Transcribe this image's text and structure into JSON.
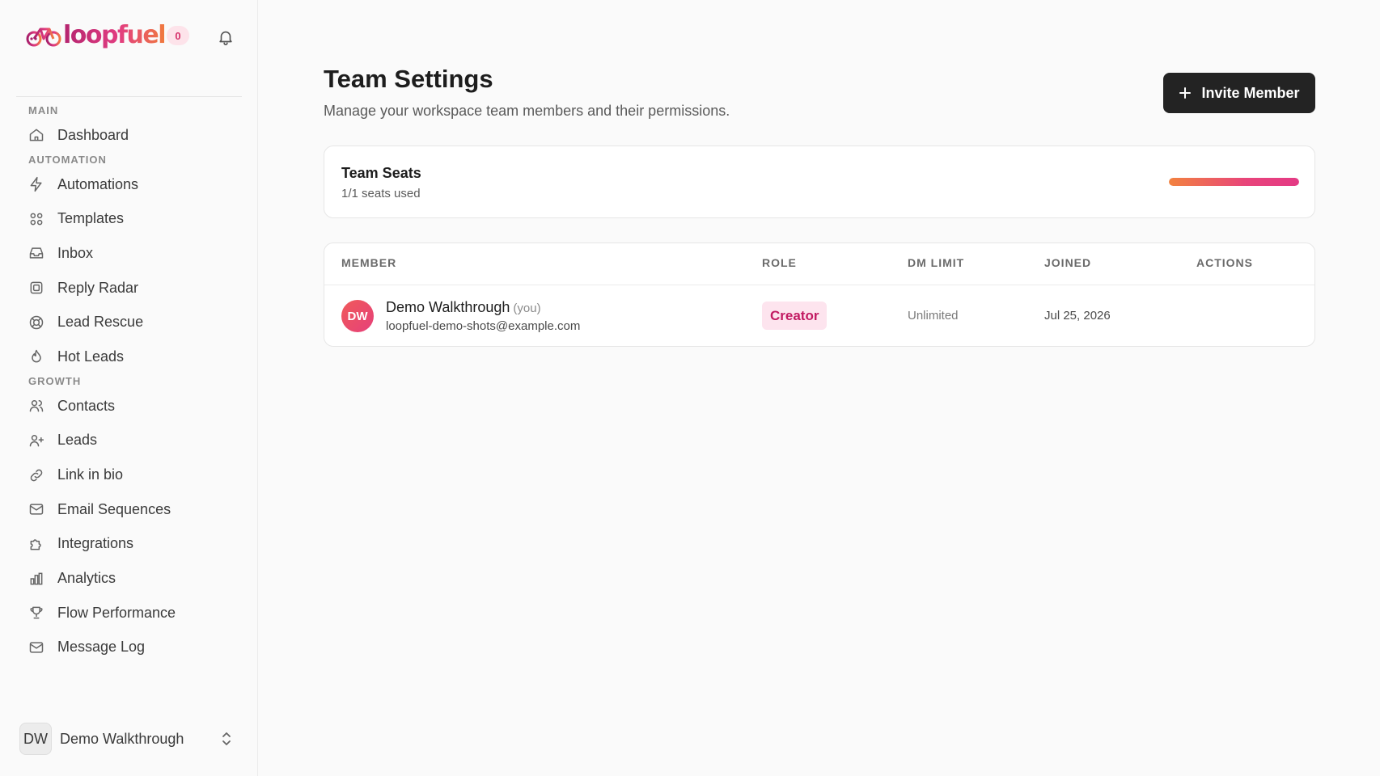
{
  "brand": {
    "name": "loopfuel",
    "badge": "0"
  },
  "sidebar": {
    "sections": [
      {
        "title": "MAIN",
        "items": [
          {
            "label": "Dashboard",
            "icon": "home-icon"
          }
        ]
      },
      {
        "title": "AUTOMATION",
        "items": [
          {
            "label": "Automations",
            "icon": "zap-icon"
          },
          {
            "label": "Templates",
            "icon": "grid-icon"
          },
          {
            "label": "Inbox",
            "icon": "inbox-icon"
          },
          {
            "label": "Reply Radar",
            "icon": "radar-icon"
          },
          {
            "label": "Lead Rescue",
            "icon": "lifebuoy-icon"
          },
          {
            "label": "Hot Leads",
            "icon": "flame-icon"
          }
        ]
      },
      {
        "title": "GROWTH",
        "items": [
          {
            "label": "Contacts",
            "icon": "users-icon"
          },
          {
            "label": "Leads",
            "icon": "user-plus-icon"
          },
          {
            "label": "Link in bio",
            "icon": "link-icon"
          },
          {
            "label": "Email Sequences",
            "icon": "mail-icon"
          },
          {
            "label": "Integrations",
            "icon": "puzzle-icon"
          },
          {
            "label": "Analytics",
            "icon": "bar-chart-icon"
          },
          {
            "label": "Flow Performance",
            "icon": "trophy-icon"
          },
          {
            "label": "Message Log",
            "icon": "mail-icon"
          }
        ]
      }
    ],
    "user": {
      "initials": "DW",
      "name": "Demo Walkthrough"
    }
  },
  "header": {
    "title": "Team Settings",
    "subtitle": "Manage your workspace team members and their permissions.",
    "invite_label": "Invite Member"
  },
  "seats": {
    "title": "Team Seats",
    "used_text": "1/1 seats used",
    "fill_fraction": 1.0
  },
  "table": {
    "columns": [
      "MEMBER",
      "ROLE",
      "DM LIMIT",
      "JOINED",
      "ACTIONS"
    ],
    "rows": [
      {
        "initials": "DW",
        "name": "Demo Walkthrough",
        "you": "(you)",
        "email": "loopfuel-demo-shots@example.com",
        "role": "Creator",
        "dm_limit": "Unlimited",
        "joined": "Jul 25, 2026"
      }
    ]
  },
  "colors": {
    "accent_pink": "#e23d80",
    "accent_orange": "#f07a3e",
    "button_dark": "#232323"
  }
}
